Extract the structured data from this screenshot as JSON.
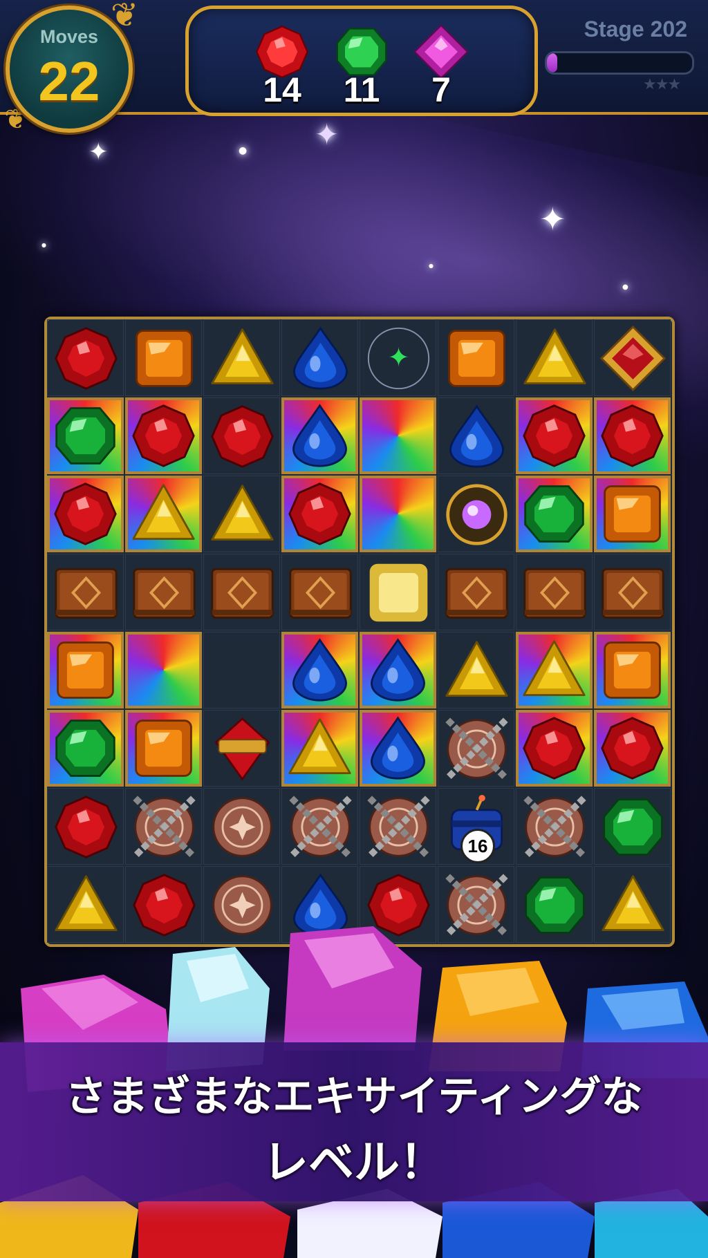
{
  "hud": {
    "moves_label": "Moves",
    "moves_value": "22",
    "goals": [
      {
        "gem": "red-gem",
        "count": "14",
        "color": "#e0141e"
      },
      {
        "gem": "green-gem",
        "count": "11",
        "color": "#1aa83a"
      },
      {
        "gem": "magenta-gem",
        "count": "7",
        "color": "#e23bc8"
      }
    ],
    "stage_label": "Stage 202",
    "progress": 0.07,
    "stars_earned": 0,
    "stars_total": 3
  },
  "board": {
    "rows": 8,
    "cols": 8,
    "cells": [
      [
        "red",
        "orange",
        "yellow",
        "blue",
        "sparkle",
        "orange",
        "yellow",
        "relic"
      ],
      [
        "green",
        "red",
        "red",
        "blue",
        "rainbow",
        "blue",
        "red",
        "red"
      ],
      [
        "red",
        "yellow",
        "yellow",
        "red",
        "rainbow",
        "orb",
        "green",
        "orange"
      ],
      [
        "book",
        "book",
        "book",
        "book",
        "glow",
        "book",
        "book",
        "book"
      ],
      [
        "orange",
        "rainbow",
        "empty",
        "blue",
        "blue",
        "yellow",
        "yellow",
        "orange"
      ],
      [
        "green",
        "orange",
        "spinner",
        "yellow",
        "blue",
        "chained",
        "red",
        "red"
      ],
      [
        "red",
        "chained",
        "rune",
        "chained",
        "chained",
        "bomb",
        "chained",
        "green"
      ],
      [
        "yellow",
        "red",
        "rune",
        "blue",
        "red",
        "chained",
        "green",
        "yellow"
      ]
    ],
    "framed": [
      [
        0,
        0,
        0,
        0,
        0,
        0,
        0,
        0
      ],
      [
        1,
        1,
        0,
        1,
        1,
        0,
        1,
        1
      ],
      [
        1,
        1,
        0,
        1,
        1,
        0,
        1,
        1
      ],
      [
        0,
        0,
        0,
        0,
        0,
        0,
        0,
        0
      ],
      [
        1,
        1,
        0,
        1,
        1,
        0,
        1,
        1
      ],
      [
        1,
        1,
        0,
        1,
        1,
        0,
        1,
        1
      ],
      [
        0,
        0,
        0,
        0,
        0,
        0,
        0,
        0
      ],
      [
        0,
        0,
        0,
        0,
        0,
        0,
        0,
        0
      ]
    ],
    "bomb_counter": "16"
  },
  "colors": {
    "red": "#d8141c",
    "orange": "#f58a12",
    "yellow": "#f2c81a",
    "blue": "#1a5fe0",
    "green": "#18b23a",
    "gold": "#d9a12d"
  },
  "banner": {
    "line1": "さまざまなエキサイティングな",
    "line2": "レベル！"
  }
}
